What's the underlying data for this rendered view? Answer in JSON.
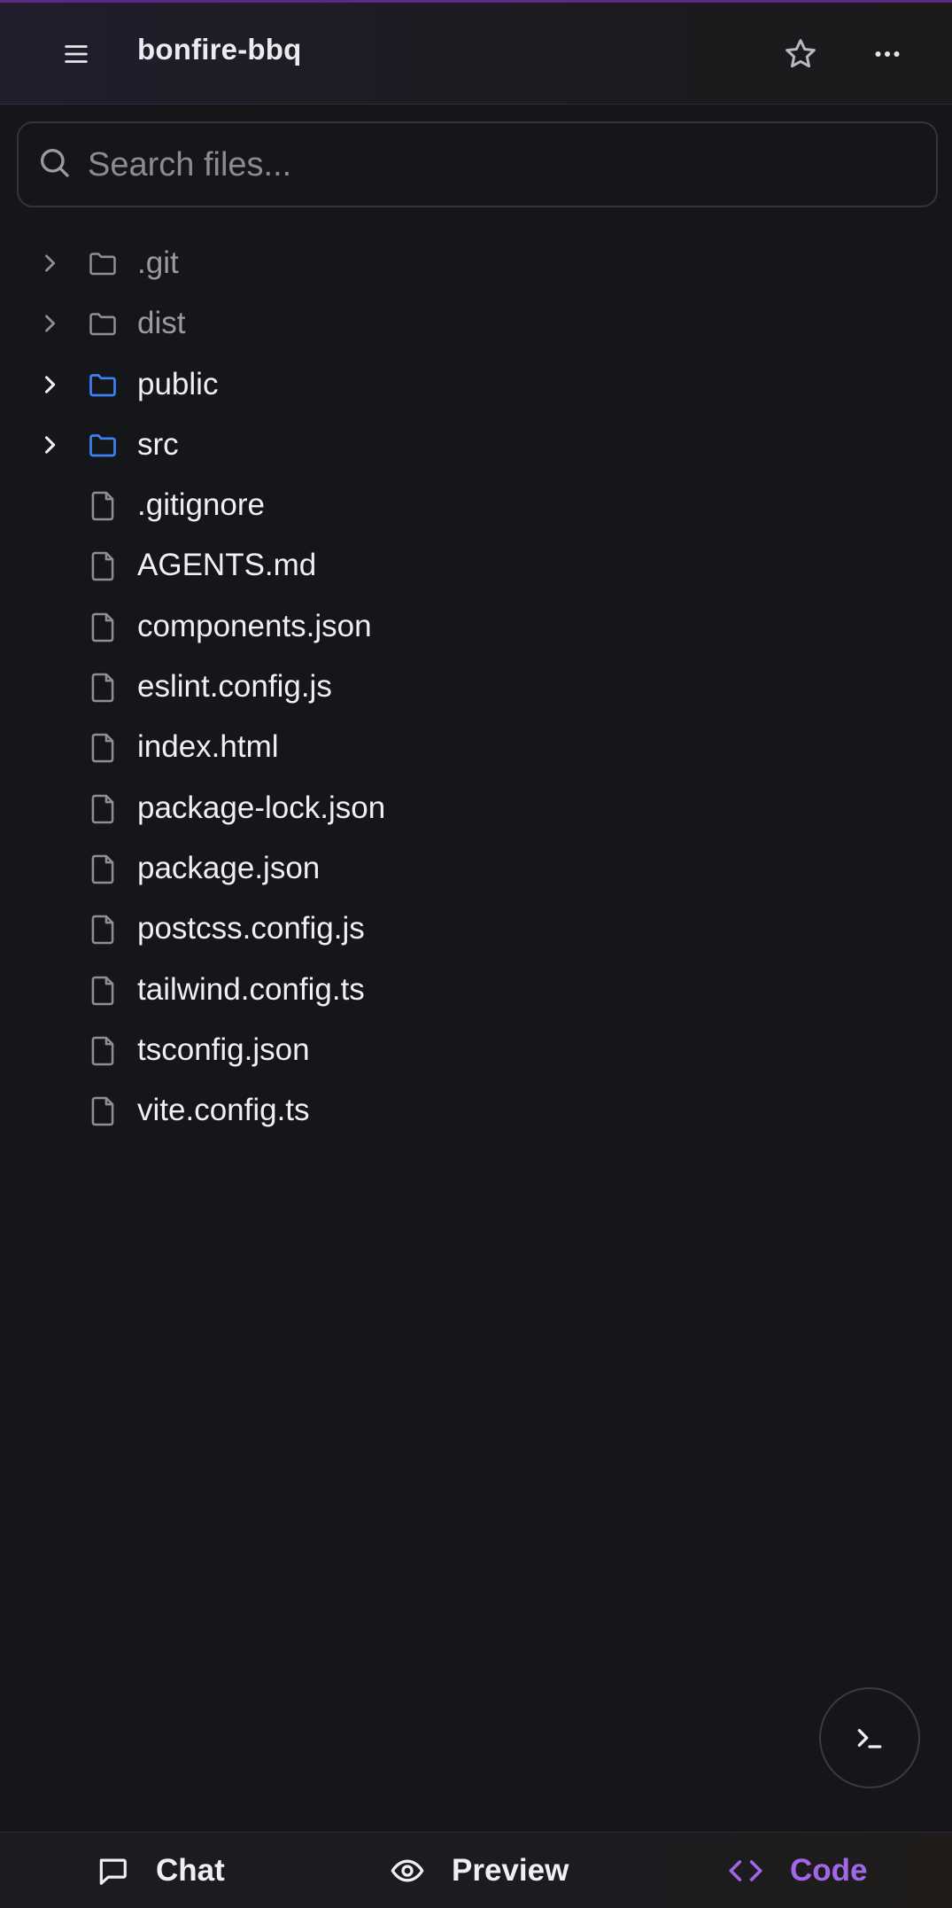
{
  "header": {
    "title": "bonfire-bbq",
    "menu_icon": "hamburger-menu-icon",
    "star_icon": "star-icon",
    "more_icon": "more-horizontal-icon"
  },
  "search": {
    "placeholder": "Search files...",
    "value": ""
  },
  "tree": {
    "items": [
      {
        "name": ".git",
        "type": "folder",
        "dimmed": true
      },
      {
        "name": "dist",
        "type": "folder",
        "dimmed": true
      },
      {
        "name": "public",
        "type": "folder",
        "dimmed": false
      },
      {
        "name": "src",
        "type": "folder",
        "dimmed": false
      },
      {
        "name": ".gitignore",
        "type": "file"
      },
      {
        "name": "AGENTS.md",
        "type": "file"
      },
      {
        "name": "components.json",
        "type": "file"
      },
      {
        "name": "eslint.config.js",
        "type": "file"
      },
      {
        "name": "index.html",
        "type": "file"
      },
      {
        "name": "package-lock.json",
        "type": "file"
      },
      {
        "name": "package.json",
        "type": "file"
      },
      {
        "name": "postcss.config.js",
        "type": "file"
      },
      {
        "name": "tailwind.config.ts",
        "type": "file"
      },
      {
        "name": "tsconfig.json",
        "type": "file"
      },
      {
        "name": "vite.config.ts",
        "type": "file"
      }
    ]
  },
  "fab": {
    "icon": "terminal-icon"
  },
  "bottom_nav": {
    "tabs": [
      {
        "label": "Chat",
        "icon": "message-square-icon",
        "active": false
      },
      {
        "label": "Preview",
        "icon": "eye-icon",
        "active": false
      },
      {
        "label": "Code",
        "icon": "code-icon",
        "active": true
      }
    ]
  },
  "colors": {
    "background": "#15161a",
    "accent": "#a266e8",
    "folder_active": "#3b82f6",
    "folder_dim": "#8e8f96",
    "file_icon": "#8e8f96"
  }
}
